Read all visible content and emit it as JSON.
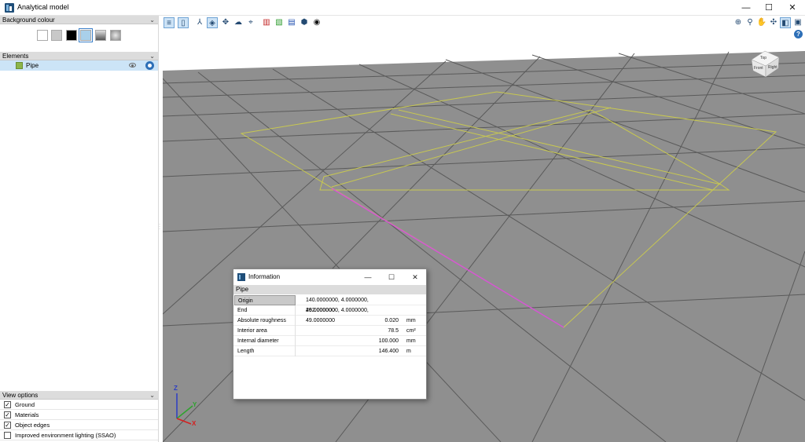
{
  "window": {
    "title": "Analytical model",
    "minimize_glyph": "—",
    "maximize_glyph": "☐",
    "close_glyph": "✕"
  },
  "left_panel": {
    "background_section": {
      "label": "Background colour",
      "swatches": [
        {
          "name": "white",
          "color": "#ffffff"
        },
        {
          "name": "light-gray",
          "color": "#c8c8c8"
        },
        {
          "name": "black",
          "color": "#000000"
        },
        {
          "name": "light-blue",
          "color": "#a9d0ea",
          "selected": true
        },
        {
          "name": "gray-gradient",
          "color": "#8a8a8a"
        },
        {
          "name": "radial-gradient",
          "color": "#b0b0b0"
        }
      ]
    },
    "elements_section": {
      "label": "Elements",
      "items": [
        {
          "label": "Pipe",
          "color": "#8cb54a",
          "visibility_icon": "eye-icon",
          "settings_icon": "gear-icon"
        }
      ]
    },
    "splitter_glyph": "....",
    "view_options": {
      "label": "View options",
      "options": [
        {
          "label": "Ground",
          "checked": true
        },
        {
          "label": "Materials",
          "checked": true
        },
        {
          "label": "Object edges",
          "checked": true
        },
        {
          "label": "Improved environment lighting (SSAO)",
          "checked": false
        }
      ]
    }
  },
  "toolbar": {
    "left_icons": [
      "layers-icon",
      "page-icon",
      "axes-icon",
      "shield-icon",
      "move-icon",
      "eye-cloud-icon",
      "orbit-icon",
      "section-red-icon",
      "section-green-icon",
      "section-blue-icon",
      "box-icon",
      "visibility-icon"
    ],
    "right_icons": [
      "zoom-extents-icon",
      "zoom-icon",
      "pan-icon",
      "rotate-icon",
      "view-icon",
      "help-book-icon"
    ],
    "help_icon": "help-icon"
  },
  "viewcube": {
    "top_label": "Top",
    "front_label": "Front",
    "right_label": "Right"
  },
  "axes": {
    "x": "X",
    "y": "Y",
    "z": "Z"
  },
  "colors": {
    "ground": "#8f8f8f",
    "grid": "#5a5a5a",
    "outline": "#c8c850",
    "pipe": "#d455d4",
    "selection": "#cce4f7"
  },
  "info_dialog": {
    "title": "Information",
    "minimize_glyph": "—",
    "maximize_glyph": "☐",
    "close_glyph": "✕",
    "group": "Pipe",
    "properties": [
      {
        "name": "Origin",
        "value": "140.0000000, 4.0000000, 49.0000000",
        "unit": ""
      },
      {
        "name": "End",
        "value": "262.0000000, 4.0000000, 49.0000000",
        "unit": ""
      },
      {
        "name": "Absolute roughness",
        "value": "0.020",
        "unit": "mm"
      },
      {
        "name": "Interior area",
        "value": "78.5",
        "unit": "cm²"
      },
      {
        "name": "Internal diameter",
        "value": "100.000",
        "unit": "mm"
      },
      {
        "name": "Length",
        "value": "146.400",
        "unit": "m"
      }
    ]
  }
}
